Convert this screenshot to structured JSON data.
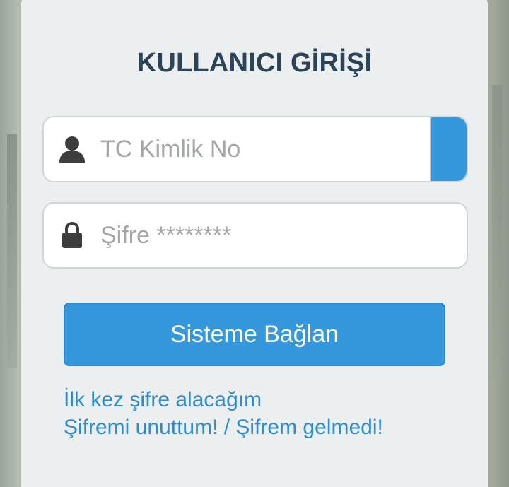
{
  "login": {
    "title": "KULLANICI GİRİŞİ",
    "tc_field": {
      "placeholder": "TC Kimlik No",
      "value": "",
      "icon": "user-icon"
    },
    "password_field": {
      "placeholder": "Şifre ********",
      "value": "",
      "icon": "lock-icon"
    },
    "submit_label": "Sisteme Bağlan",
    "links": {
      "first_time": "İlk kez şifre alacağım",
      "forgot": "Şifremi unuttum! / Şifrem gelmedi!"
    }
  },
  "colors": {
    "accent": "#3598dc",
    "title": "#2d4358",
    "link": "#2f8ccb",
    "card_bg": "#eceff0"
  }
}
